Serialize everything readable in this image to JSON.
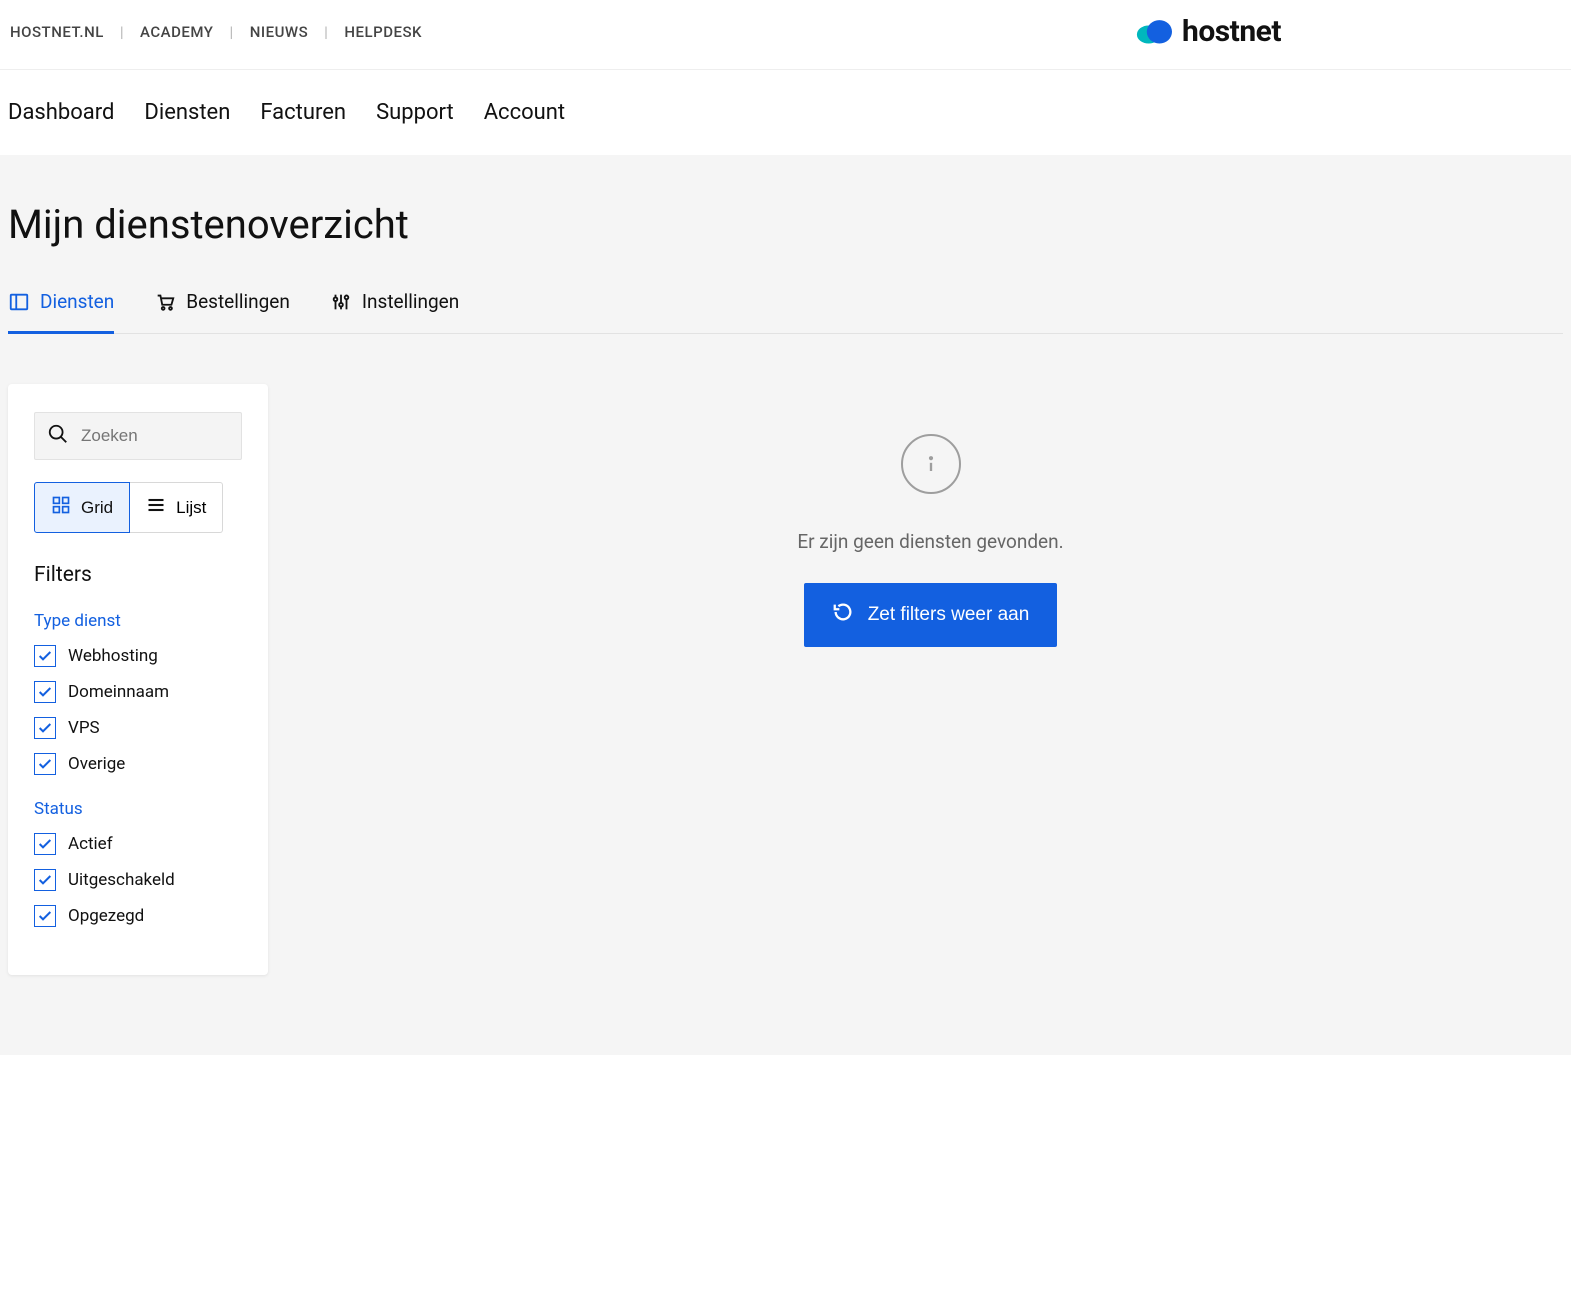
{
  "topLinks": {
    "hostnet": "HOSTNET.NL",
    "academy": "ACADEMY",
    "nieuws": "NIEUWS",
    "helpdesk": "HELPDESK"
  },
  "brand": "hostnet",
  "primaryNav": {
    "dashboard": "Dashboard",
    "diensten": "Diensten",
    "facturen": "Facturen",
    "support": "Support",
    "account": "Account"
  },
  "pageTitle": "Mijn dienstenoverzicht",
  "tabs": {
    "diensten": "Diensten",
    "bestellingen": "Bestellingen",
    "instellingen": "Instellingen"
  },
  "search": {
    "placeholder": "Zoeken"
  },
  "view": {
    "grid": "Grid",
    "lijst": "Lijst"
  },
  "filtersTitle": "Filters",
  "filterGroups": {
    "typeDienst": {
      "title": "Type dienst",
      "items": {
        "webhosting": "Webhosting",
        "domeinnaam": "Domeinnaam",
        "vps": "VPS",
        "overige": "Overige"
      }
    },
    "status": {
      "title": "Status",
      "items": {
        "actief": "Actief",
        "uitgeschakeld": "Uitgeschakeld",
        "opgezegd": "Opgezegd"
      }
    }
  },
  "empty": {
    "message": "Er zijn geen diensten gevonden.",
    "resetBtn": "Zet filters weer aan"
  }
}
